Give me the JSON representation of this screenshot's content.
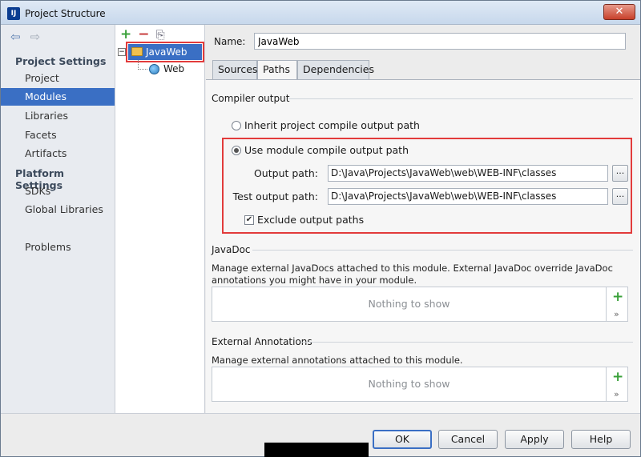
{
  "window": {
    "title": "Project Structure",
    "app_icon": "intellij-logo-icon",
    "close": "✕"
  },
  "nav": {
    "back_icon": "arrow-left-icon",
    "forward_icon": "arrow-right-icon",
    "project_settings_label": "Project Settings",
    "platform_settings_label": "Platform Settings",
    "items": [
      {
        "label": "Project"
      },
      {
        "label": "Modules"
      },
      {
        "label": "Libraries"
      },
      {
        "label": "Facets"
      },
      {
        "label": "Artifacts"
      },
      {
        "label": "SDKs"
      },
      {
        "label": "Global Libraries"
      },
      {
        "label": "Problems"
      }
    ],
    "selected": "Modules"
  },
  "tree": {
    "add_icon": "+",
    "remove_icon": "−",
    "copy_icon": "⎘",
    "expander": "−",
    "root": "JavaWeb",
    "child": "Web"
  },
  "module": {
    "name_label": "Name:",
    "name_value": "JavaWeb",
    "tabs": [
      "Sources",
      "Paths",
      "Dependencies"
    ],
    "active_tab": "Paths"
  },
  "paths": {
    "compiler_output_title": "Compiler output",
    "inherit_label": "Inherit project compile output path",
    "use_module_label": "Use module compile output path",
    "selected_option": "use_module",
    "output_path_label": "Output path:",
    "output_path_value": "D:\\Java\\Projects\\JavaWeb\\web\\WEB-INF\\classes",
    "test_output_path_label": "Test output path:",
    "test_output_path_value": "D:\\Java\\Projects\\JavaWeb\\web\\WEB-INF\\classes",
    "browse_label": "...",
    "exclude_label": "Exclude output paths",
    "exclude_checked": true,
    "javadoc_title": "JavaDoc",
    "javadoc_desc": "Manage external JavaDocs attached to this module. External JavaDoc override JavaDoc annotations you might have in your module.",
    "javadoc_empty": "Nothing to show",
    "annotations_title": "External Annotations",
    "annotations_desc": "Manage external annotations attached to this module.",
    "annotations_empty": "Nothing to show",
    "list_add": "+",
    "list_more": "»"
  },
  "buttons": {
    "ok": "OK",
    "cancel": "Cancel",
    "apply": "Apply",
    "help": "Help"
  }
}
